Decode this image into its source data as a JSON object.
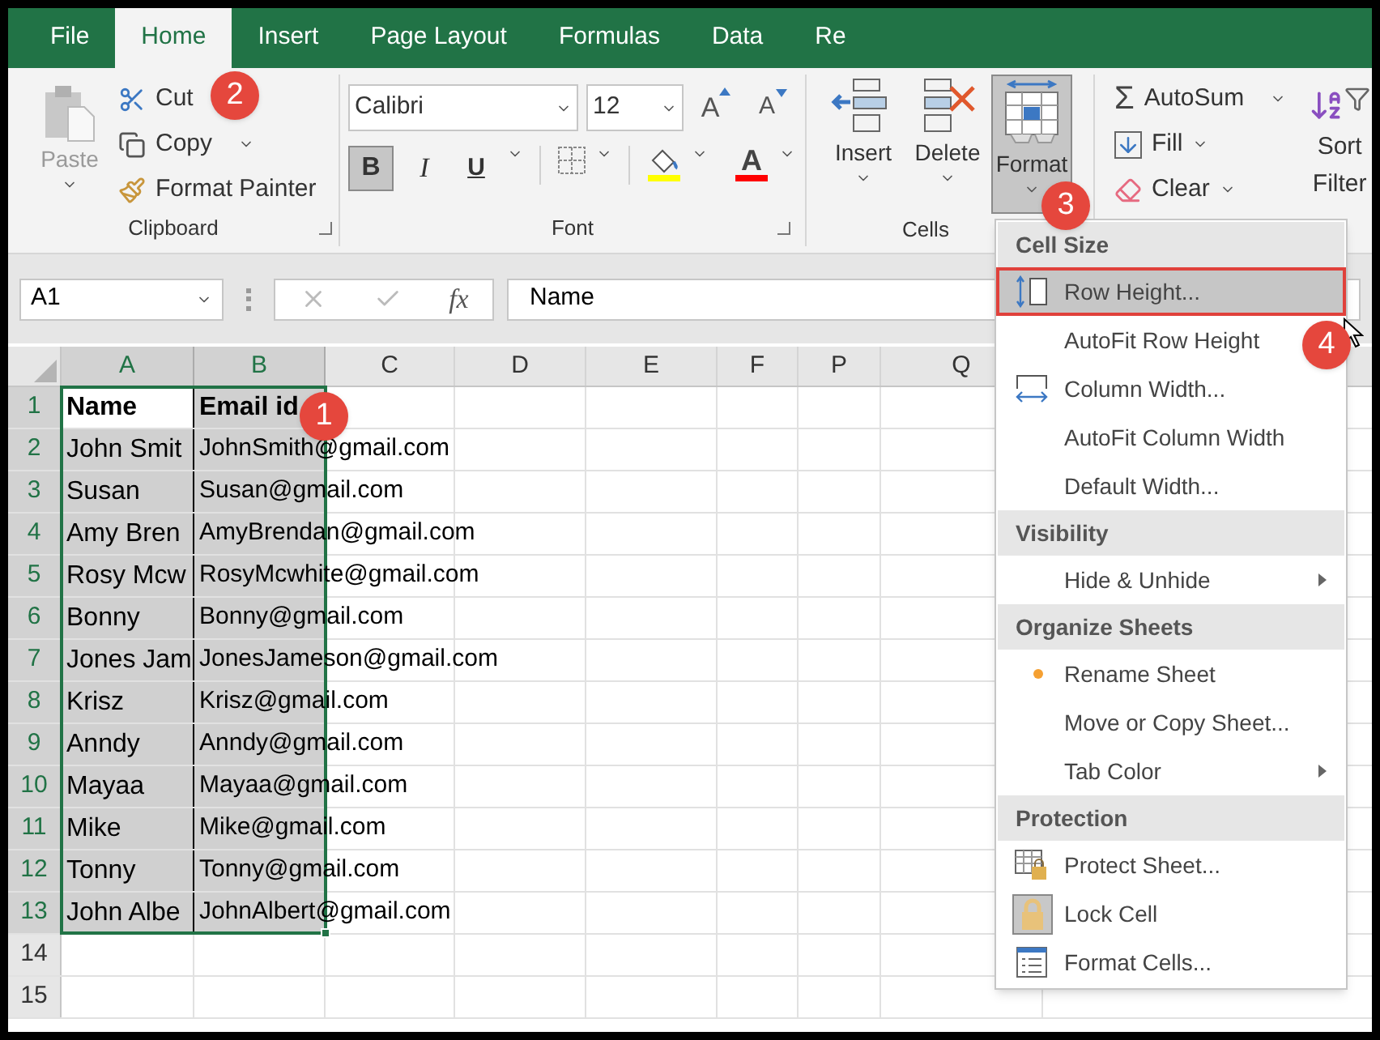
{
  "tabs": [
    {
      "label": "File",
      "selected": false
    },
    {
      "label": "Home",
      "selected": true
    },
    {
      "label": "Insert",
      "selected": false
    },
    {
      "label": "Page Layout",
      "selected": false
    },
    {
      "label": "Formulas",
      "selected": false
    },
    {
      "label": "Data",
      "selected": false
    },
    {
      "label": "Re",
      "selected": false
    }
  ],
  "ribbon": {
    "clipboard": {
      "paste": {
        "label": "Paste",
        "disabled": true
      },
      "cut": "Cut",
      "copy": "Copy",
      "format_painter": "Format Painter",
      "label": "Clipboard"
    },
    "font": {
      "name": "Calibri",
      "size": "12",
      "grow": "A",
      "shrink": "A",
      "bold": {
        "text": "B",
        "on": true
      },
      "italic": {
        "text": "I",
        "on": false
      },
      "underline": {
        "text": "U",
        "on": false
      },
      "font_color": "A",
      "label": "Font"
    },
    "cells": {
      "buttons": [
        {
          "label": "Insert",
          "kind": "insert",
          "selected": false
        },
        {
          "label": "Delete",
          "kind": "delete",
          "selected": false
        },
        {
          "label": "Format",
          "kind": "format",
          "selected": true
        }
      ],
      "label": "Cells"
    },
    "editing": {
      "autosum": {
        "symbol": "Σ",
        "label": "AutoSum"
      },
      "fill": "Fill",
      "clear": "Clear",
      "sort_filter": [
        "Sort",
        "Filter"
      ]
    }
  },
  "formula_bar": {
    "name_box": "A1",
    "fx": "fx",
    "value": "Name"
  },
  "sheet": {
    "columns": [
      {
        "label": "A",
        "selected": true
      },
      {
        "label": "B",
        "selected": true
      },
      {
        "label": "C",
        "selected": false
      },
      {
        "label": "D",
        "selected": false
      },
      {
        "label": "E",
        "selected": false
      },
      {
        "label": "F",
        "selected": false
      },
      {
        "label": "P",
        "selected": false
      },
      {
        "label": "Q",
        "selected": false
      }
    ],
    "rows": [
      {
        "number": "1",
        "selected": true,
        "bold": true,
        "cells": [
          {
            "text": "Name",
            "active": true
          },
          {
            "text": "Email id",
            "active": false
          }
        ]
      },
      {
        "number": "2",
        "selected": true,
        "bold": false,
        "cells": [
          {
            "text": "John Smit",
            "active": false
          },
          {
            "text": "JohnSmith@gmail.com",
            "active": false
          }
        ]
      },
      {
        "number": "3",
        "selected": true,
        "bold": false,
        "cells": [
          {
            "text": "Susan",
            "active": false
          },
          {
            "text": "Susan@gmail.com",
            "active": false
          }
        ]
      },
      {
        "number": "4",
        "selected": true,
        "bold": false,
        "cells": [
          {
            "text": "Amy Bren",
            "active": false
          },
          {
            "text": "AmyBrendan@gmail.com",
            "active": false
          }
        ]
      },
      {
        "number": "5",
        "selected": true,
        "bold": false,
        "cells": [
          {
            "text": "Rosy Mcw",
            "active": false
          },
          {
            "text": "RosyMcwhite@gmail.com",
            "active": false
          }
        ]
      },
      {
        "number": "6",
        "selected": true,
        "bold": false,
        "cells": [
          {
            "text": "Bonny",
            "active": false
          },
          {
            "text": "Bonny@gmail.com",
            "active": false
          }
        ]
      },
      {
        "number": "7",
        "selected": true,
        "bold": false,
        "cells": [
          {
            "text": "Jones Jam",
            "active": false
          },
          {
            "text": "JonesJameson@gmail.com",
            "active": false
          }
        ]
      },
      {
        "number": "8",
        "selected": true,
        "bold": false,
        "cells": [
          {
            "text": "Krisz",
            "active": false
          },
          {
            "text": "Krisz@gmail.com",
            "active": false
          }
        ]
      },
      {
        "number": "9",
        "selected": true,
        "bold": false,
        "cells": [
          {
            "text": "Anndy",
            "active": false
          },
          {
            "text": "Anndy@gmail.com",
            "active": false
          }
        ]
      },
      {
        "number": "10",
        "selected": true,
        "bold": false,
        "cells": [
          {
            "text": "Mayaa",
            "active": false
          },
          {
            "text": "Mayaa@gmail.com",
            "active": false
          }
        ]
      },
      {
        "number": "11",
        "selected": true,
        "bold": false,
        "cells": [
          {
            "text": "Mike",
            "active": false
          },
          {
            "text": "Mike@gmail.com",
            "active": false
          }
        ]
      },
      {
        "number": "12",
        "selected": true,
        "bold": false,
        "cells": [
          {
            "text": "Tonny",
            "active": false
          },
          {
            "text": "Tonny@gmail.com",
            "active": false
          }
        ]
      },
      {
        "number": "13",
        "selected": true,
        "bold": false,
        "cells": [
          {
            "text": "John Albe",
            "active": false
          },
          {
            "text": "JohnAlbert@gmail.com",
            "active": false
          }
        ]
      },
      {
        "number": "14",
        "selected": false,
        "cells": []
      },
      {
        "number": "15",
        "selected": false,
        "cells": []
      }
    ]
  },
  "menu": {
    "sections": [
      {
        "title": "Cell Size",
        "items": [
          {
            "label": "Row Height...",
            "kind": "row-height",
            "selected": true,
            "submenu": false
          },
          {
            "label": "AutoFit Row Height",
            "kind": "plain",
            "selected": false,
            "submenu": false
          },
          {
            "label": "Column Width...",
            "kind": "column-width",
            "selected": false,
            "submenu": false
          },
          {
            "label": "AutoFit Column Width",
            "kind": "plain",
            "selected": false,
            "submenu": false
          },
          {
            "label": "Default Width...",
            "kind": "plain",
            "selected": false,
            "submenu": false
          }
        ]
      },
      {
        "title": "Visibility",
        "items": [
          {
            "label": "Hide & Unhide",
            "kind": "plain",
            "selected": false,
            "submenu": true
          }
        ]
      },
      {
        "title": "Organize Sheets",
        "items": [
          {
            "label": "Rename Sheet",
            "kind": "dot",
            "selected": false,
            "submenu": false
          },
          {
            "label": "Move or Copy Sheet...",
            "kind": "plain",
            "selected": false,
            "submenu": false
          },
          {
            "label": "Tab Color",
            "kind": "plain",
            "selected": false,
            "submenu": true
          }
        ]
      },
      {
        "title": "Protection",
        "items": [
          {
            "label": "Protect Sheet...",
            "kind": "protect",
            "selected": false,
            "submenu": false
          },
          {
            "label": "Lock Cell",
            "kind": "lock",
            "selected": false,
            "submenu": false
          },
          {
            "label": "Format Cells...",
            "kind": "format-cells",
            "selected": false,
            "submenu": false
          }
        ]
      }
    ]
  },
  "callouts": [
    {
      "text": "1"
    },
    {
      "text": "2"
    },
    {
      "text": "3"
    },
    {
      "text": "4"
    }
  ]
}
